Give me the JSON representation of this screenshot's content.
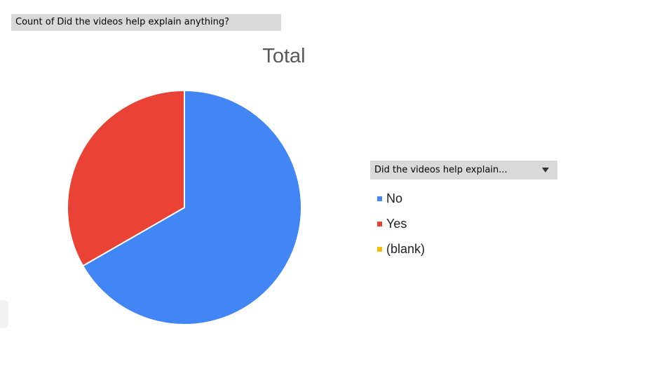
{
  "field_button": {
    "label": "Count of Did the videos help explain anything?"
  },
  "chart_data": {
    "type": "pie",
    "title": "Total",
    "legend_title": "Did the videos help explain...",
    "legend_position": "right",
    "slices": [
      {
        "label": "No",
        "value": 66.7,
        "color": "#4285f4"
      },
      {
        "label": "Yes",
        "value": 33.3,
        "color": "#ea4335"
      },
      {
        "label": "(blank)",
        "value": 0,
        "color": "#fbbc04"
      }
    ]
  }
}
